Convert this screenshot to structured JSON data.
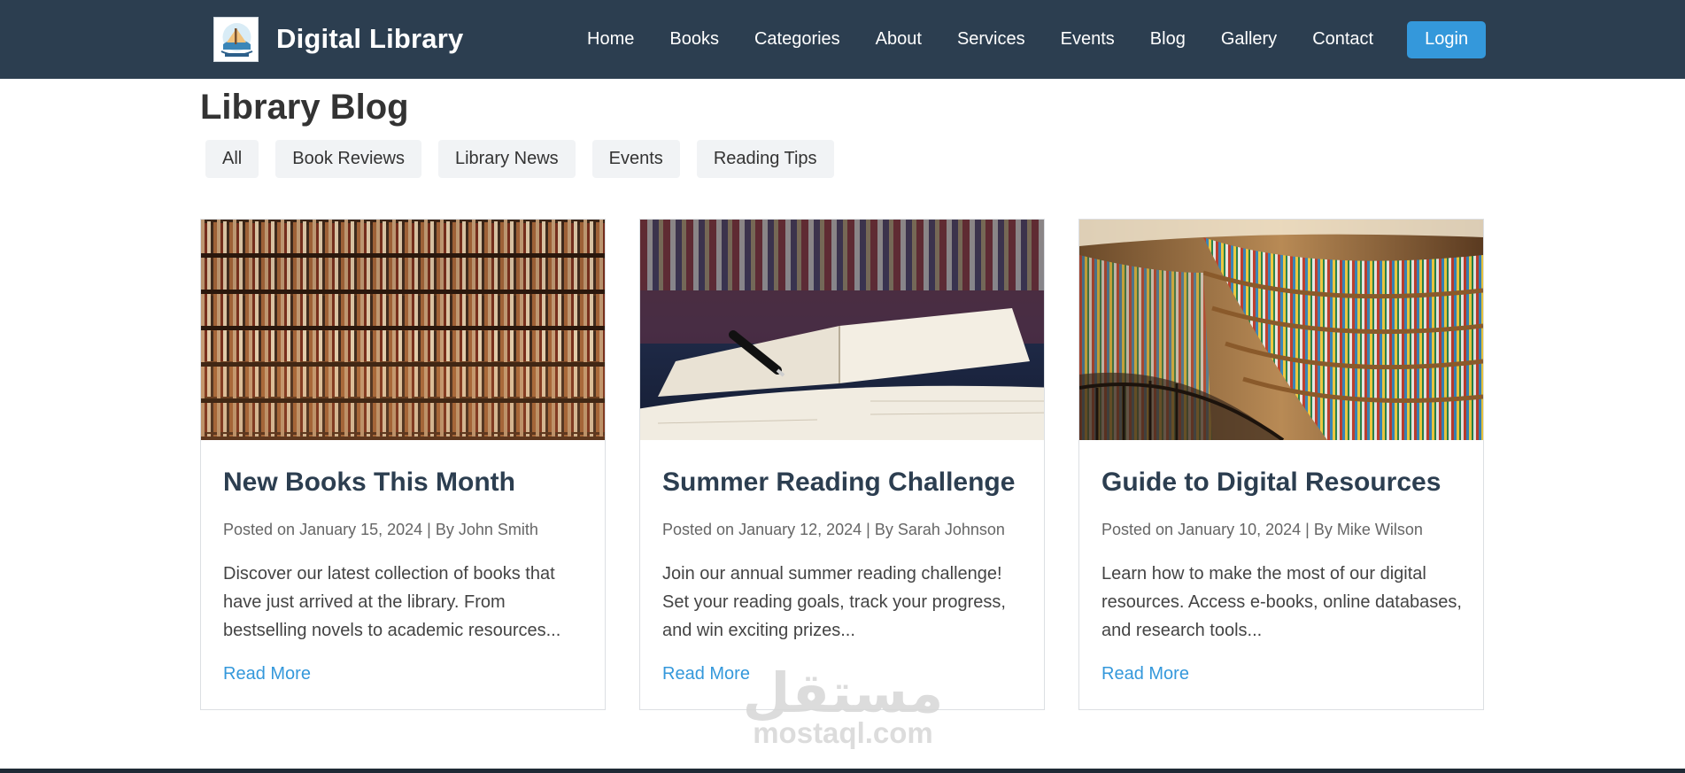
{
  "header": {
    "brand": "Digital Library",
    "nav": [
      "Home",
      "Books",
      "Categories",
      "About",
      "Services",
      "Events",
      "Blog",
      "Gallery",
      "Contact"
    ],
    "login_label": "Login"
  },
  "page": {
    "title": "Library Blog"
  },
  "filters": [
    "All",
    "Book Reviews",
    "Library News",
    "Events",
    "Reading Tips"
  ],
  "posts": [
    {
      "title": "New Books This Month",
      "meta": "Posted on January 15, 2024 | By John Smith",
      "excerpt": "Discover our latest collection of books that have just arrived at the library. From bestselling novels to academic resources...",
      "read_more": "Read More",
      "image": "bookshelf-photo"
    },
    {
      "title": "Summer Reading Challenge",
      "meta": "Posted on January 12, 2024 | By Sarah Johnson",
      "excerpt": "Join our annual summer reading challenge! Set your reading goals, track your progress, and win exciting prizes...",
      "read_more": "Read More",
      "image": "open-book-pen-photo"
    },
    {
      "title": "Guide to Digital Resources",
      "meta": "Posted on January 10, 2024 | By Mike Wilson",
      "excerpt": "Learn how to make the most of our digital resources. Access e-books, online databases, and research tools...",
      "read_more": "Read More",
      "image": "curved-library-shelves-photo"
    }
  ],
  "watermark": {
    "arabic": "مستقل",
    "latin": "mostaql.com"
  },
  "colors": {
    "navbar": "#2c3e50",
    "accent": "#3498db",
    "title": "#2c3e50"
  }
}
